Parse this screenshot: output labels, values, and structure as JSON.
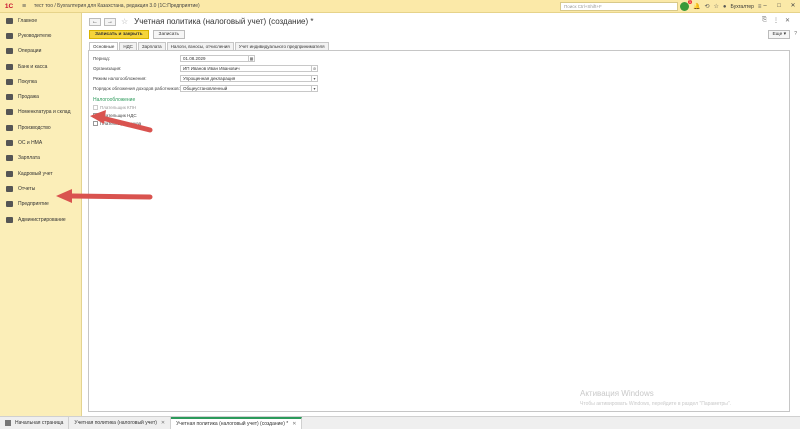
{
  "app": {
    "logo": "1С",
    "title": "тест тоо / Бухгалтерия для Казахстана, редакция 3.0  (1С:Предприятие)",
    "search_placeholder": "Поиск Ctrl+Shift+F",
    "notification_count": "1",
    "user": "Бухгалтер",
    "accent_color": "#f5d43a",
    "sidebar_bg": "#fbeeb8"
  },
  "sidebar": {
    "items": [
      {
        "label": "Главное",
        "icon": "menu-icon"
      },
      {
        "label": "Руководителю",
        "icon": "chart-icon"
      },
      {
        "label": "Операции",
        "icon": "operations-icon"
      },
      {
        "label": "Банк и касса",
        "icon": "bank-icon"
      },
      {
        "label": "Покупка",
        "icon": "cart-icon"
      },
      {
        "label": "Продажа",
        "icon": "sale-icon"
      },
      {
        "label": "Номенклатура и склад",
        "icon": "warehouse-icon"
      },
      {
        "label": "Производство",
        "icon": "factory-icon"
      },
      {
        "label": "ОС и НМА",
        "icon": "assets-icon"
      },
      {
        "label": "Зарплата",
        "icon": "salary-icon"
      },
      {
        "label": "Кадровый учет",
        "icon": "people-icon"
      },
      {
        "label": "Отчеты",
        "icon": "reports-icon"
      },
      {
        "label": "Предприятие",
        "icon": "enterprise-icon"
      },
      {
        "label": "Администрирование",
        "icon": "settings-icon"
      }
    ]
  },
  "document": {
    "back": "←",
    "forward": "→",
    "title": "Учетная политика (налоговый учет) (создание) *",
    "save_close_label": "Записать и закрыть",
    "save_label": "Записать",
    "more_label": "Еще ▾",
    "tabs": [
      "Основные",
      "НДС",
      "Зарплата",
      "Налоги, взносы, отчисления",
      "Учет индивидуального предпринимателя"
    ],
    "fields": {
      "period_label": "Период:",
      "period_value": "01.08.2029",
      "org_label": "Организация:",
      "org_value": "ИП Иванов Иван Иванович",
      "tax_regime_label": "Режим налогообложения:",
      "tax_regime_value": "Упрощенная декларация",
      "income_tax_label": "Порядок обложения доходов работников:",
      "income_tax_value": "Общеустановленный"
    },
    "section_title": "Налогообложение",
    "checkboxes": [
      {
        "label": "Плательщик КПН",
        "checked": false,
        "disabled": true
      },
      {
        "label": "Плательщик НДС",
        "checked": true,
        "disabled": false
      },
      {
        "label": "Плательщик акциза",
        "checked": false,
        "disabled": false
      }
    ]
  },
  "watermark": {
    "line1": "Активация Windows",
    "line2": "Чтобы активировать Windows, перейдите в раздел \"Параметры\"."
  },
  "bottom_tabs": [
    {
      "label": "Начальная страница",
      "active": false
    },
    {
      "label": "Учетная политика (налоговый учет)",
      "active": false
    },
    {
      "label": "Учетная политика (налоговый учет) (создание) *",
      "active": true
    }
  ]
}
